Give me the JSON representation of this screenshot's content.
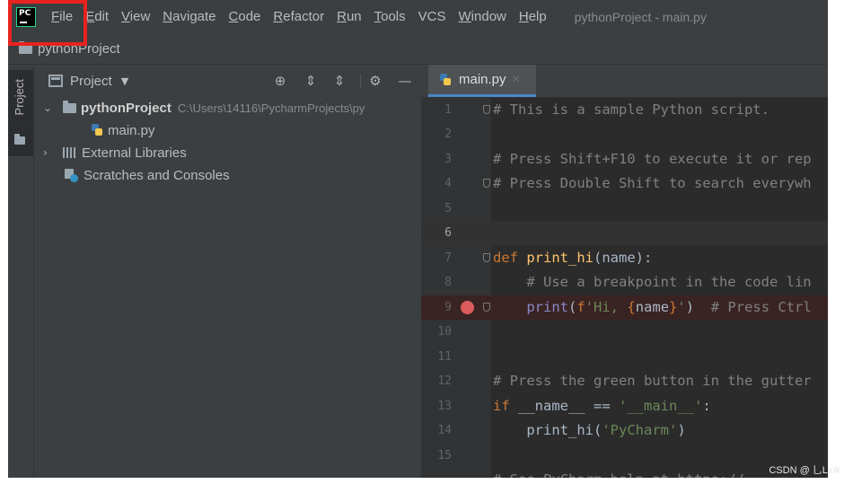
{
  "menubar": {
    "logo_text": "PC",
    "items": [
      {
        "mnemonic": "F",
        "rest": "ile"
      },
      {
        "mnemonic": "E",
        "rest": "dit"
      },
      {
        "mnemonic": "V",
        "rest": "iew"
      },
      {
        "mnemonic": "N",
        "rest": "avigate"
      },
      {
        "mnemonic": "C",
        "rest": "ode"
      },
      {
        "mnemonic": "R",
        "rest": "efactor"
      },
      {
        "mnemonic": "R",
        "rest": "un"
      },
      {
        "mnemonic": "T",
        "rest": "ools"
      },
      {
        "mnemonic": "",
        "rest": "VCS"
      },
      {
        "mnemonic": "W",
        "rest": "indow"
      },
      {
        "mnemonic": "H",
        "rest": "elp"
      }
    ],
    "window_title": "pythonProject - main.py"
  },
  "navbar": {
    "crumb": "pythonProject"
  },
  "toolstrip": {
    "project_tab": "Project"
  },
  "project_panel": {
    "title": "Project",
    "caret": "▼",
    "buttons": {
      "locate": "⊕",
      "expand": "⇕",
      "collapse": "⇕",
      "settings": "⚙",
      "hide": "—"
    },
    "tree": {
      "root": {
        "label": "pythonProject",
        "path": "C:\\Users\\14116\\PycharmProjects\\py"
      },
      "file": {
        "label": "main.py"
      },
      "libraries": {
        "label": "External Libraries"
      },
      "scratches": {
        "label": "Scratches and Consoles"
      }
    }
  },
  "editor": {
    "tab": {
      "label": "main.py",
      "close": "×"
    },
    "lines": [
      "1",
      "2",
      "3",
      "4",
      "5",
      "6",
      "7",
      "8",
      "9",
      "10",
      "11",
      "12",
      "13",
      "14",
      "15"
    ],
    "code": {
      "l1": "# This is a sample Python script.",
      "l3": "# Press Shift+F10 to execute it or rep",
      "l4": "# Press Double Shift to search everywh",
      "l7_kw": "def",
      "l7_fn": "print_hi",
      "l7_rest": "(name):",
      "l8": "    # Use a breakpoint in the code lin",
      "l9_indent": "    ",
      "l9_fn": "print",
      "l9_p1": "(",
      "l9_f": "f",
      "l9_s1": "'Hi, ",
      "l9_b1": "{",
      "l9_var": "name",
      "l9_b2": "}",
      "l9_s2": "'",
      "l9_p2": ")  ",
      "l9_com": "# Press Ctrl",
      "l12": "# Press the green button in the gutter",
      "l13_kw": "if",
      "l13_rest1": " __name__ == ",
      "l13_str": "'__main__'",
      "l13_rest2": ":",
      "l14_fn": "    print_hi(",
      "l14_str": "'PyCharm'",
      "l14_end": ")",
      "l16": "# See PyCharm help at https://"
    }
  },
  "watermark": "CSDN @ 乚Link",
  "colors": {
    "highlight": "#e8231f",
    "breakpoint": "#db5c5c",
    "accent": "#4a88c7"
  }
}
